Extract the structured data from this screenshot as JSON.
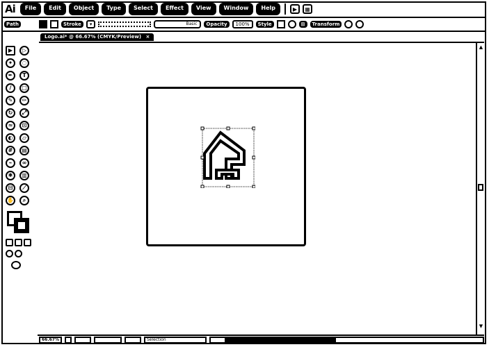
{
  "app": {
    "logo": "Ai"
  },
  "menu": {
    "items": [
      "File",
      "Edit",
      "Object",
      "Type",
      "Select",
      "Effect",
      "View",
      "Window",
      "Help"
    ]
  },
  "control": {
    "selection_label": "Path",
    "stroke_label": "Stroke",
    "stroke_style": "Basic",
    "opacity_label": "Opacity",
    "opacity_value": "100%",
    "style_label": "Style",
    "transform_label": "Transform"
  },
  "document": {
    "tab_title": "Logo.ai* @ 66.67% (CMYK/Preview)",
    "tab_close": "×"
  },
  "status": {
    "zoom": "66.67%",
    "tool_name": "Selection"
  },
  "colors": {
    "ink": "#000000",
    "paper": "#ffffff"
  }
}
